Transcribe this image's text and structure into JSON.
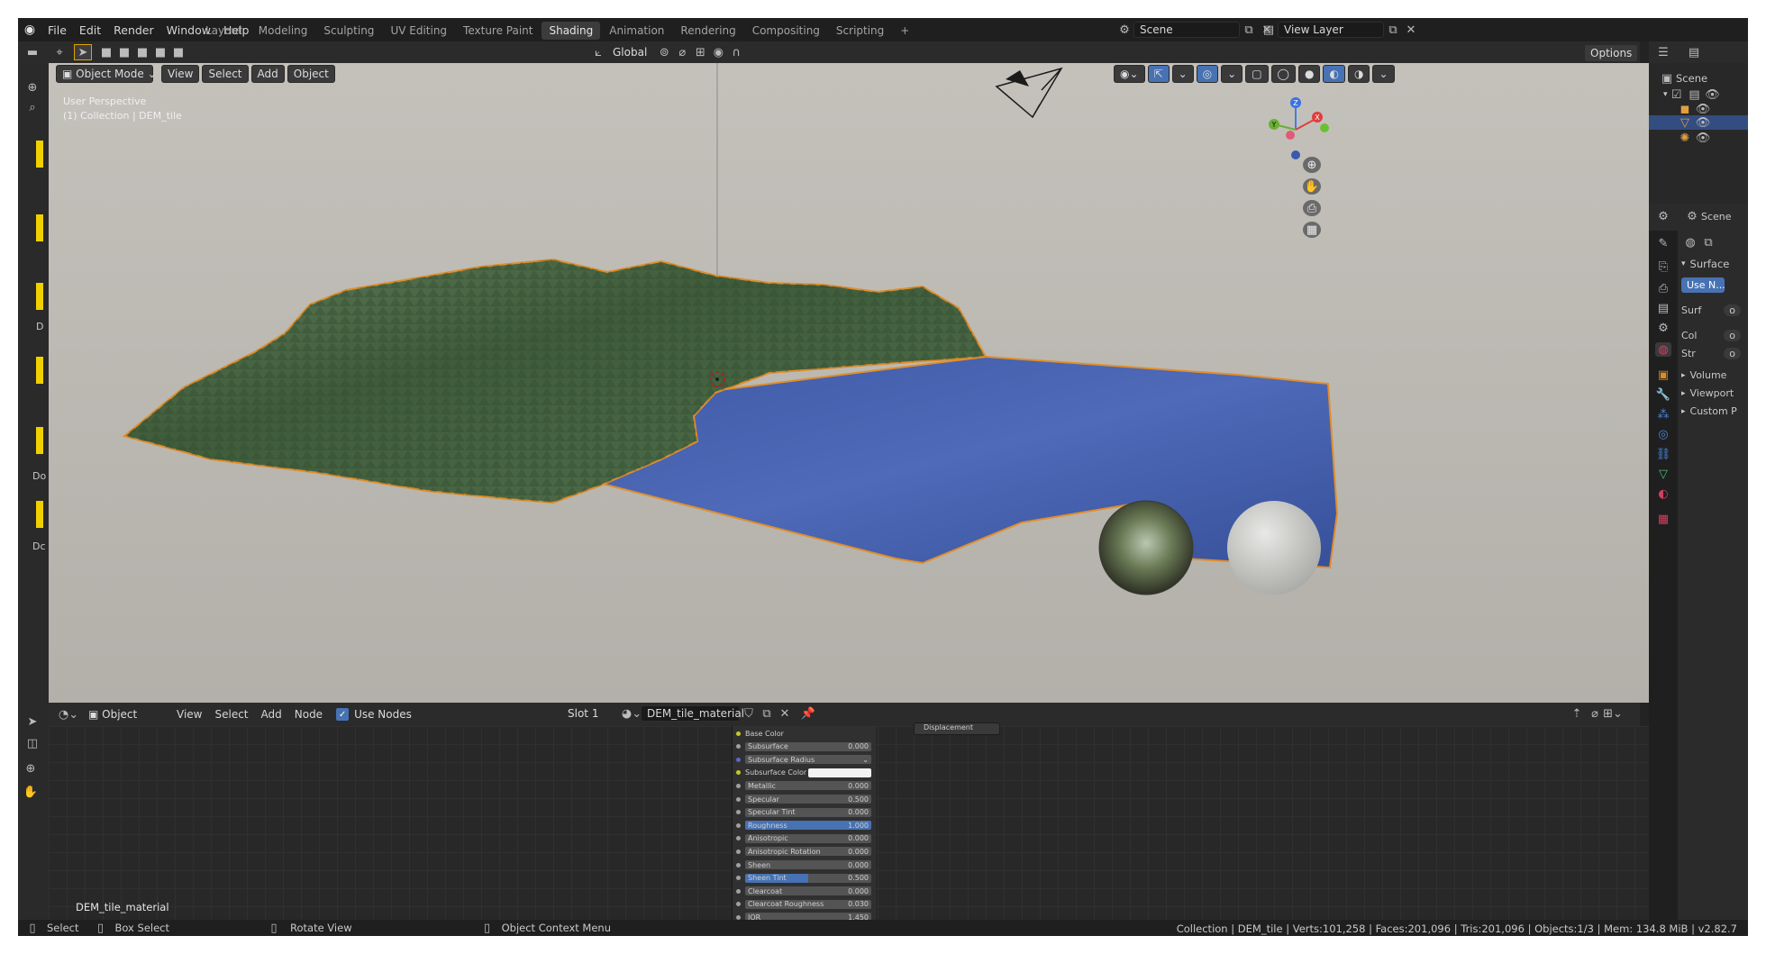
{
  "topbar": {
    "menus": [
      "File",
      "Edit",
      "Render",
      "Window",
      "Help"
    ],
    "workspaces": [
      {
        "label": "Layout",
        "active": false
      },
      {
        "label": "Modeling",
        "active": false
      },
      {
        "label": "Sculpting",
        "active": false
      },
      {
        "label": "UV Editing",
        "active": false
      },
      {
        "label": "Texture Paint",
        "active": false
      },
      {
        "label": "Shading",
        "active": true
      },
      {
        "label": "Animation",
        "active": false
      },
      {
        "label": "Rendering",
        "active": false
      },
      {
        "label": "Compositing",
        "active": false
      },
      {
        "label": "Scripting",
        "active": false
      }
    ],
    "add_workspace": "+",
    "scene_name": "Scene",
    "view_layer": "View Layer"
  },
  "viewport_toolbar": {
    "transform_orientation": "Global",
    "options_label": "Options"
  },
  "viewport_header": {
    "mode": "Object Mode",
    "menus": [
      "View",
      "Select",
      "Add",
      "Object"
    ]
  },
  "viewport": {
    "perspective_label": "User Perspective",
    "collection_label": "(1) Collection | DEM_tile",
    "gizmo_axes": {
      "x": "X",
      "y": "Y",
      "z": "Z"
    }
  },
  "left_toolbar_labels": [
    "D",
    "Do",
    "Dc"
  ],
  "outliner": {
    "root": "Scene"
  },
  "properties": {
    "scene_label": "Scene",
    "surface_header": "Surface",
    "use_nodes_button": "Use N...",
    "rows": [
      {
        "label": "Surf",
        "value": "o"
      },
      {
        "label": "Col",
        "value": "o"
      },
      {
        "label": "Str",
        "value": "o"
      }
    ],
    "collapsed_panels": [
      "Volume",
      "Viewport",
      "Custom P"
    ]
  },
  "node_header": {
    "type_label": "Object",
    "menus": [
      "View",
      "Select",
      "Add",
      "Node"
    ],
    "use_nodes_label": "Use Nodes",
    "use_nodes_checked": true,
    "slot": "Slot 1",
    "material_name": "DEM_tile_material"
  },
  "node_editor": {
    "material_label": "DEM_tile_material",
    "output_socket": "Displacement",
    "bsdf_inputs": [
      {
        "label": "Base Color",
        "value": "",
        "kind": "header",
        "socket": "#c7c729"
      },
      {
        "label": "Subsurface",
        "value": "0.000",
        "kind": "bar",
        "socket": "#a0a0a0"
      },
      {
        "label": "Subsurface Radius",
        "value": "",
        "kind": "dropdown",
        "socket": "#6363c7"
      },
      {
        "label": "Subsurface Color",
        "value": "",
        "kind": "color",
        "socket": "#c7c729"
      },
      {
        "label": "Metallic",
        "value": "0.000",
        "kind": "bar",
        "socket": "#a0a0a0"
      },
      {
        "label": "Specular",
        "value": "0.500",
        "kind": "bar",
        "socket": "#a0a0a0"
      },
      {
        "label": "Specular Tint",
        "value": "0.000",
        "kind": "bar",
        "socket": "#a0a0a0"
      },
      {
        "label": "Roughness",
        "value": "1.000",
        "kind": "full",
        "socket": "#a0a0a0"
      },
      {
        "label": "Anisotropic",
        "value": "0.000",
        "kind": "bar",
        "socket": "#a0a0a0"
      },
      {
        "label": "Anisotropic Rotation",
        "value": "0.000",
        "kind": "bar",
        "socket": "#a0a0a0"
      },
      {
        "label": "Sheen",
        "value": "0.000",
        "kind": "bar",
        "socket": "#a0a0a0"
      },
      {
        "label": "Sheen Tint",
        "value": "0.500",
        "kind": "half",
        "socket": "#a0a0a0"
      },
      {
        "label": "Clearcoat",
        "value": "0.000",
        "kind": "bar",
        "socket": "#a0a0a0"
      },
      {
        "label": "Clearcoat Roughness",
        "value": "0.030",
        "kind": "bar",
        "socket": "#a0a0a0"
      },
      {
        "label": "IOR",
        "value": "1.450",
        "kind": "bar",
        "socket": "#a0a0a0"
      }
    ]
  },
  "statusbar": {
    "select": "Select",
    "box_select": "Box Select",
    "rotate_view": "Rotate View",
    "context_menu": "Object Context Menu",
    "stats": "Collection | DEM_tile | Verts:101,258 | Faces:201,096 | Tris:201,096 | Objects:1/3 | Mem: 134.8 MiB | v2.82.7"
  }
}
